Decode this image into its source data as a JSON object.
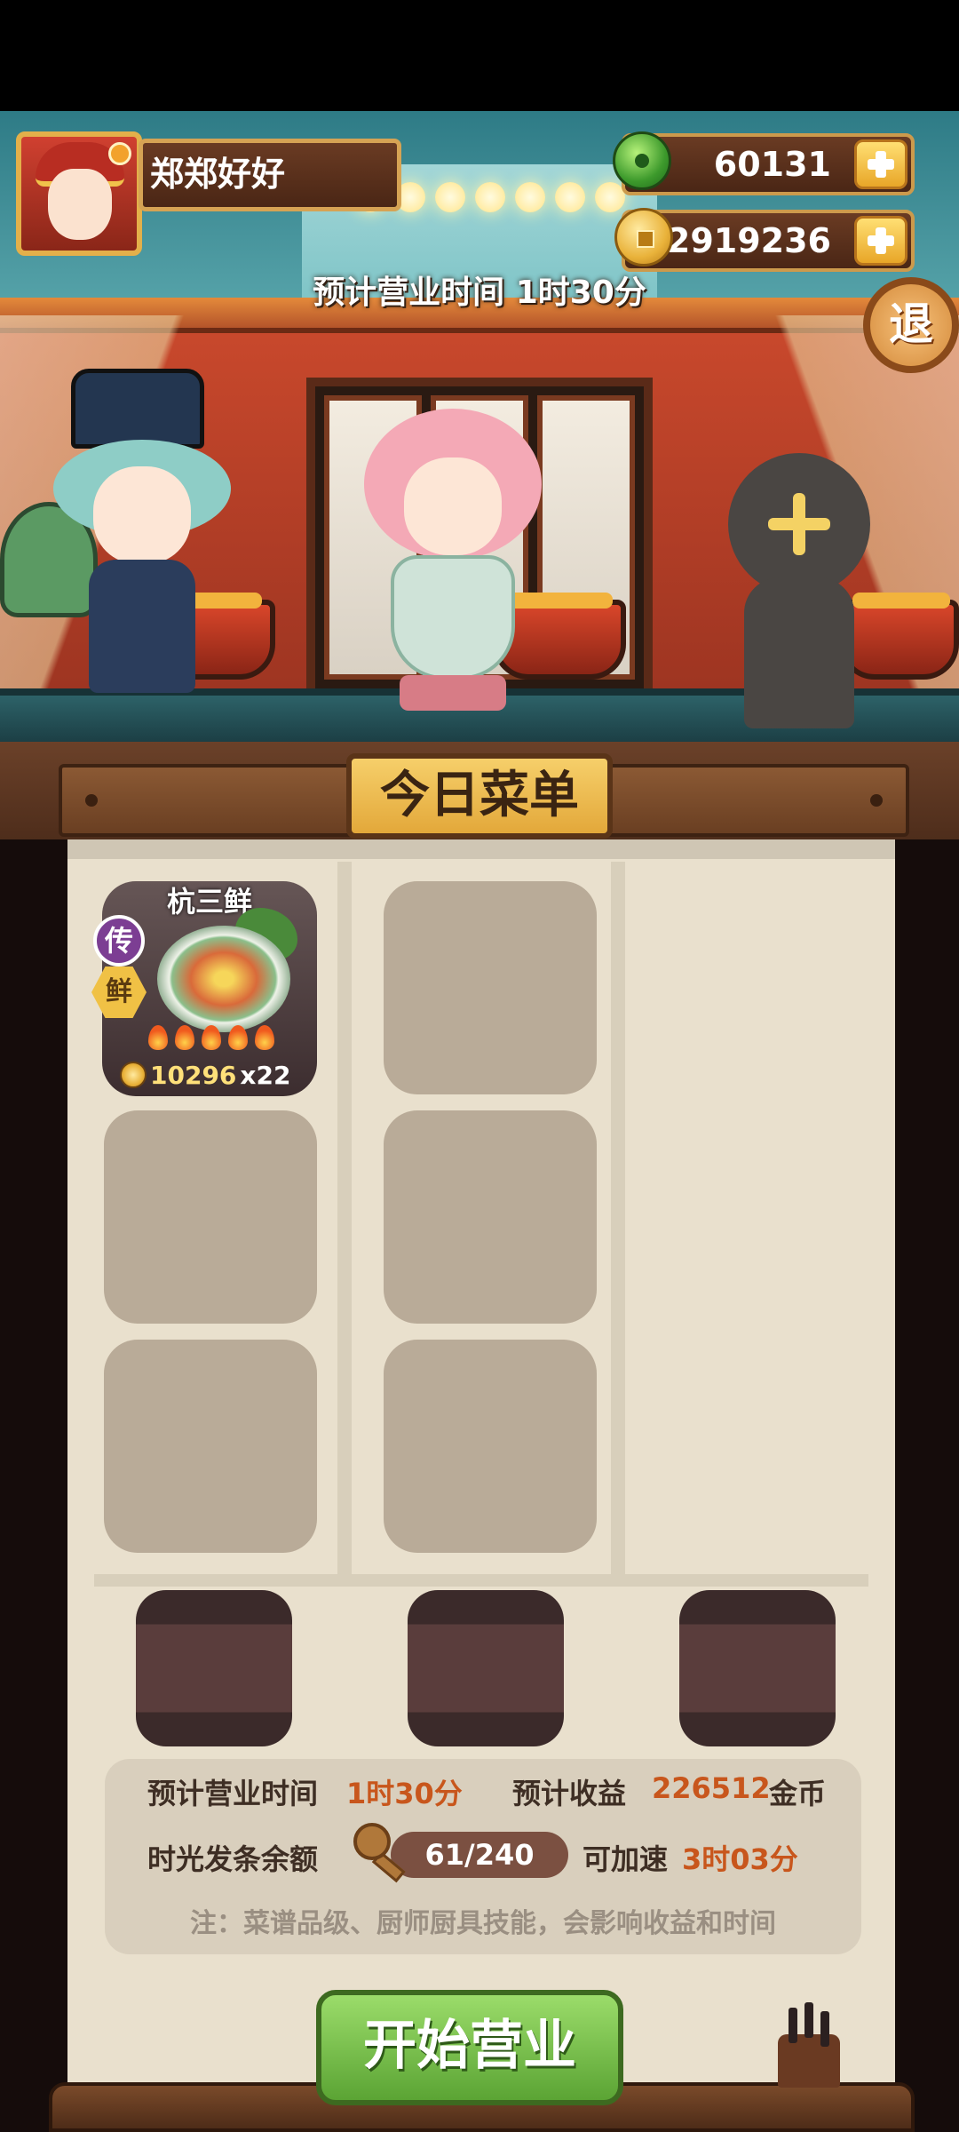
{
  "player": {
    "name": "郑郑好好"
  },
  "currency": {
    "jade": "60131",
    "coins": "52919236"
  },
  "scene": {
    "estimated_time_banner": "预计营业时间  1时30分",
    "exit_label": "退"
  },
  "menu": {
    "title": "今日菜单",
    "dishes": [
      {
        "name": "杭三鲜",
        "rarity_label": "传",
        "trait_label": "鲜",
        "price": "10296",
        "quantity": "x22",
        "flames": 5
      }
    ]
  },
  "summary": {
    "time_label": "预计营业时间",
    "time_value": "1时30分",
    "income_label": "预计收益",
    "income_value": "226512",
    "income_unit": "金币",
    "spring_label": "时光发条余额",
    "spring_value": "61/240",
    "speedup_label": "可加速",
    "speedup_value": "3时03分",
    "note": "注：菜谱品级、厨师厨具技能，会影响收益和时间"
  },
  "actions": {
    "start_label": "开始营业"
  },
  "colors": {
    "accent_orange": "#c8561c",
    "start_green": "#5ba434",
    "panel_bg": "#e9e0cd"
  }
}
